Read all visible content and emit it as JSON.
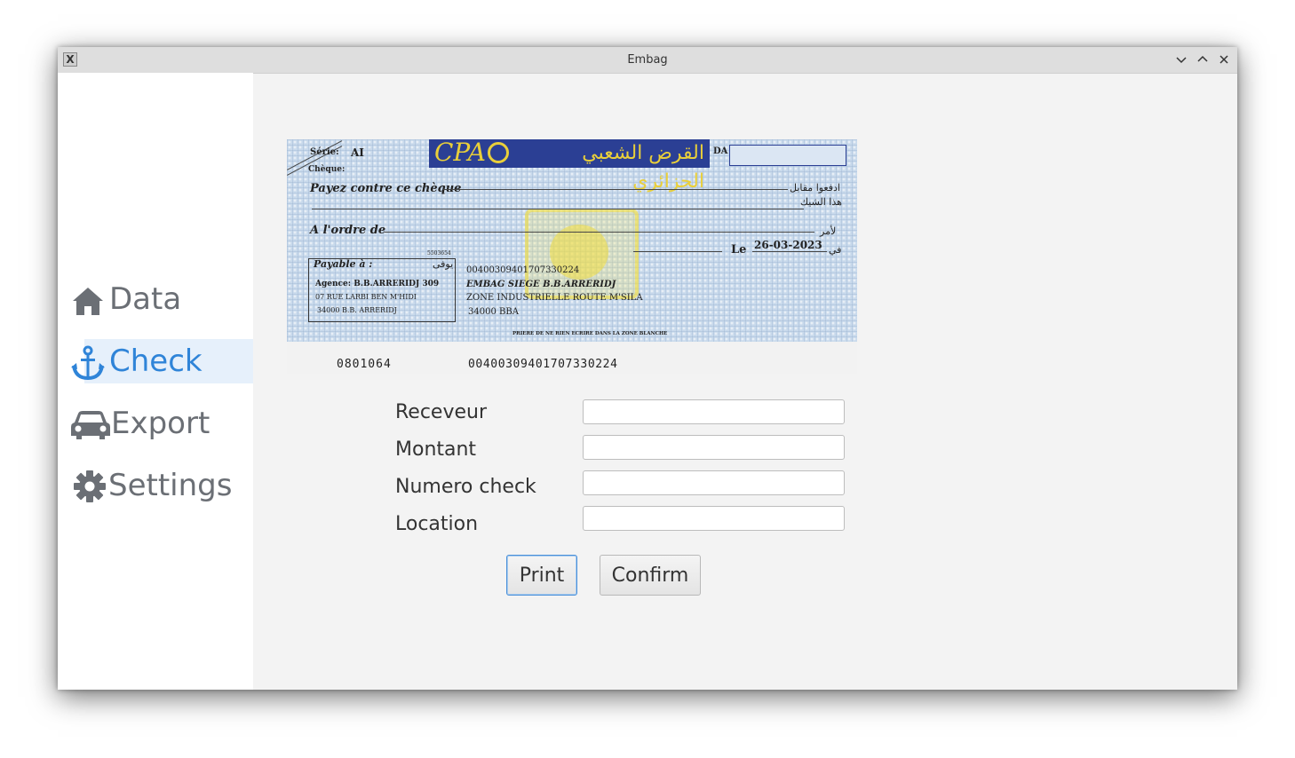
{
  "window": {
    "title": "Embag",
    "app_icon": "x11-icon"
  },
  "window_controls": {
    "minimize_icon": "chevron-down-icon",
    "maximize_icon": "chevron-up-icon",
    "close_icon": "close-icon"
  },
  "sidebar": {
    "items": [
      {
        "label": "Data",
        "icon": "home-icon",
        "active": false
      },
      {
        "label": "Check",
        "icon": "anchor-icon",
        "active": true
      },
      {
        "label": "Export",
        "icon": "car-icon",
        "active": false
      },
      {
        "label": "Settings",
        "icon": "gear-icon",
        "active": false
      }
    ]
  },
  "cheque": {
    "serie_label": "Série:",
    "serie_value": "AI",
    "cheque_label": "Chèque:",
    "bank_code": "CPA",
    "bank_name_ar": "القرض الشعبي الجزائري",
    "currency": "DA",
    "pay_label": "Payez contre ce chèque",
    "pay_label_ar": "ادفعوا مقابل",
    "pay_label_ar2": "هذا الشيك",
    "order_label": "A l'ordre de",
    "order_label_ar": "لأمر",
    "date_prefix": "Le",
    "date_prefix_ar": "في",
    "date": "26-03-2023",
    "payable_label": "Payable à :",
    "payable_label_ar": "يوفى",
    "agency_code": "5503654",
    "agency": "Agence:  B.B.ARRERIDJ 309",
    "agency_address": "07 RUE LARBI BEN M'HIDI",
    "agency_city": "34000 B.B. ARRERIDJ",
    "account_number": "00400309401707330224",
    "holder_name": "EMBAG SIEGE B.B.ARRERIDJ",
    "holder_address": "ZONE INDUSTRIELLE ROUTE M'SILA",
    "holder_city": "34000    BBA",
    "notice": "PRIERE DE NE RIEN ECRIRE DANS LA ZONE BLANCHE",
    "micr_cheque": "0801064",
    "micr_account": "00400309401707330224"
  },
  "form": {
    "receiver_label": "Receveur",
    "receiver_value": "",
    "amount_label": "Montant",
    "amount_value": "",
    "check_number_label": "Numero check",
    "check_number_value": "",
    "location_label": "Location",
    "location_value": ""
  },
  "actions": {
    "print_label": "Print",
    "confirm_label": "Confirm"
  },
  "colors": {
    "accent": "#2f84d8",
    "sidebar_text": "#6b6f75",
    "active_bg": "#e6f0fb",
    "cheque_band": "#2b3f94",
    "cheque_gold": "#e9cf3a"
  }
}
